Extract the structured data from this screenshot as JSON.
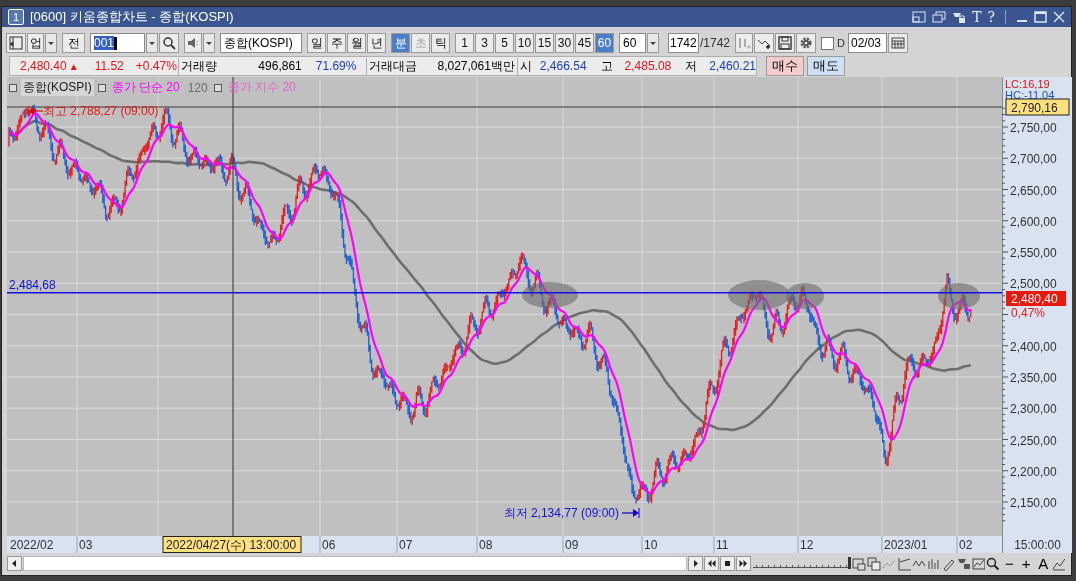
{
  "window": {
    "number": "1",
    "title": "[0600] 키움종합차트 - 종합(KOSPI)",
    "title_glyphs": [
      "T",
      "?"
    ]
  },
  "toolbar": {
    "market": "업",
    "scope": "전",
    "code": "001",
    "name": "종합(KOSPI)",
    "periods": [
      {
        "label": "일",
        "selected": false,
        "disabled": false
      },
      {
        "label": "주",
        "selected": false,
        "disabled": false
      },
      {
        "label": "월",
        "selected": false,
        "disabled": false
      },
      {
        "label": "년",
        "selected": false,
        "disabled": false
      },
      {
        "label": "분",
        "selected": true,
        "disabled": false
      },
      {
        "label": "초",
        "selected": false,
        "disabled": true
      },
      {
        "label": "틱",
        "selected": false,
        "disabled": false
      }
    ],
    "intervals": [
      {
        "label": "1",
        "selected": false
      },
      {
        "label": "3",
        "selected": false
      },
      {
        "label": "5",
        "selected": false
      },
      {
        "label": "10",
        "selected": false
      },
      {
        "label": "15",
        "selected": false
      },
      {
        "label": "30",
        "selected": false
      },
      {
        "label": "45",
        "selected": false
      },
      {
        "label": "60",
        "selected": true
      }
    ],
    "interval_value": "60",
    "count": "1742",
    "total": "/1742",
    "checkbox": {
      "label": "D",
      "checked": false
    },
    "date": "02/03"
  },
  "quote": {
    "price": "2,480.40",
    "arrow": "▲",
    "change": "11.52",
    "change_pct": "+0.47%",
    "volume_label": "거래량",
    "volume": "496,861",
    "volume_pct": "71.69%",
    "amount_label": "거래대금",
    "amount": "8,027,061백만",
    "open_label": "시",
    "open": "2,466.54",
    "high_label": "고",
    "high": "2,485.08",
    "low_label": "저",
    "low": "2,460.21",
    "buy": "매수",
    "sell": "매도"
  },
  "chart": {
    "legend": [
      {
        "text": "종합(KOSPI)",
        "color": "#202020",
        "marker": true
      },
      {
        "text": "종가 단순 20",
        "color": "#ff00ff",
        "marker": true
      },
      {
        "text": "120",
        "color": "#6e6e6e",
        "marker": false
      },
      {
        "text": "종가 지수 20",
        "color": "#e860d0",
        "marker": true
      }
    ],
    "high_marker": "최고 2,788,27 (09:00)",
    "low_marker": "최저 2,134,77 (09:00)",
    "level_label": "2,484,68",
    "lc": "LC:16,19",
    "hc": "HC:-11,04",
    "top_value": "2,790,16",
    "yticks": [
      "2,750,00",
      "2,700,00",
      "2,650,00",
      "2,600,00",
      "2,550,00",
      "2,500,00",
      "2,400,00",
      "2,350,00",
      "2,300,00",
      "2,250,00",
      "2,200,00",
      "2,150,00"
    ],
    "last_price": "2,480,40",
    "last_pct": "0,47%",
    "xlabels": [
      "2022/02",
      "03",
      "06",
      "07",
      "08",
      "09",
      "10",
      "11",
      "12",
      "2023/01",
      "02"
    ],
    "crosshair_time": "2022/04/27(수) 13:00:00",
    "time_label": "15:00:00"
  },
  "zoom": {
    "level": 1
  },
  "scroll_tools": [
    "−",
    "+",
    "A"
  ]
}
